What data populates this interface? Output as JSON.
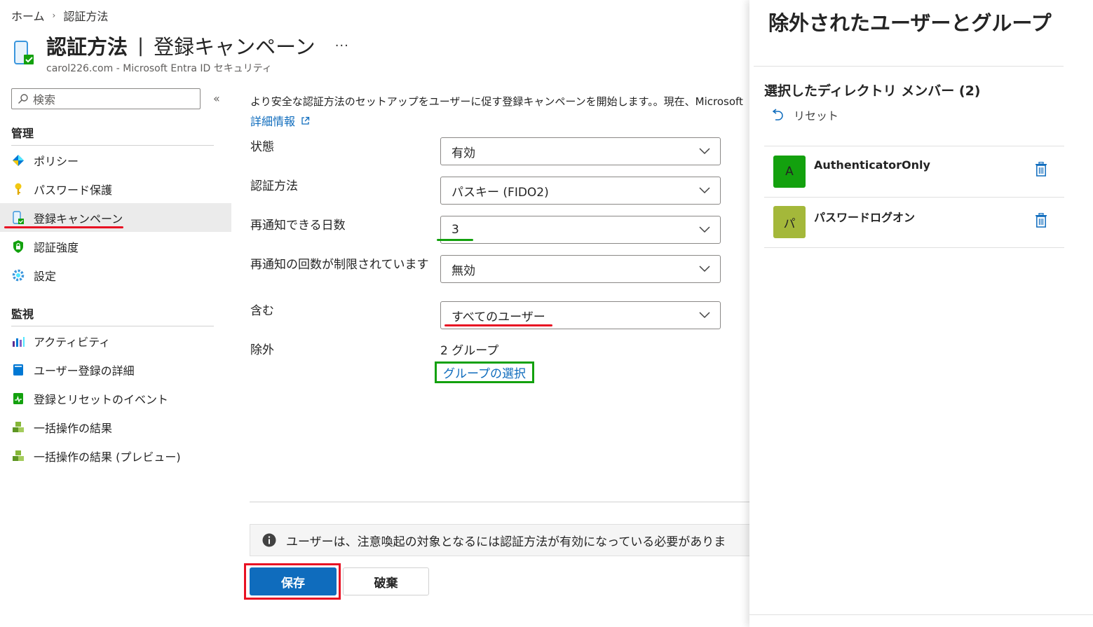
{
  "breadcrumb": {
    "home": "ホーム",
    "sep": "›",
    "current": "認証方法"
  },
  "header": {
    "title": "認証方法",
    "pipe": "|",
    "subtitle": "登録キャンペーン",
    "more": "···",
    "tenant": "carol226.com - Microsoft Entra ID セキュリティ"
  },
  "sidebar": {
    "search_placeholder": "検索",
    "collapse": "«",
    "sections": [
      {
        "heading": "管理",
        "items": [
          {
            "label": "ポリシー",
            "icon": "policy-icon"
          },
          {
            "label": "パスワード保護",
            "icon": "key-icon"
          },
          {
            "label": "登録キャンペーン",
            "icon": "phone-check-icon",
            "active": true
          },
          {
            "label": "認証強度",
            "icon": "shield-lock-icon"
          },
          {
            "label": "設定",
            "icon": "gear-icon"
          }
        ]
      },
      {
        "heading": "監視",
        "items": [
          {
            "label": "アクティビティ",
            "icon": "bar-chart-icon"
          },
          {
            "label": "ユーザー登録の詳細",
            "icon": "book-icon"
          },
          {
            "label": "登録とリセットのイベント",
            "icon": "activity-log-icon"
          },
          {
            "label": "一括操作の結果",
            "icon": "cubes-icon"
          },
          {
            "label": "一括操作の結果 (プレビュー)",
            "icon": "cubes-icon"
          }
        ]
      }
    ]
  },
  "main": {
    "description": "より安全な認証方法のセットアップをユーザーに促す登録キャンペーンを開始します。。現在、Microsoft",
    "learn_more": "詳細情報",
    "fields": {
      "state": {
        "label": "状態",
        "value": "有効"
      },
      "auth_method": {
        "label": "認証方法",
        "value": "パスキー (FIDO2)"
      },
      "snooze_days": {
        "label": "再通知できる日数",
        "value": "3"
      },
      "limited_snooze": {
        "label": "再通知の回数が制限されています",
        "value": "無効"
      },
      "include": {
        "label": "含む",
        "value": "すべてのユーザー"
      },
      "exclude": {
        "label": "除外",
        "count": "2 グループ",
        "link": "グループの選択"
      }
    },
    "info": "ユーザーは、注意喚起の対象となるには認証方法が有効になっている必要がありま",
    "save": "保存",
    "discard": "破棄"
  },
  "panel": {
    "title": "除外されたユーザーとグループ",
    "subtitle": "選択したディレクトリ メンバー (2)",
    "reset": "リセット",
    "members": [
      {
        "initial": "A",
        "name": "AuthenticatorOnly",
        "color": "#13a10e"
      },
      {
        "initial": "パ",
        "name": "パスワードログオン",
        "color": "#a4b83a"
      }
    ]
  },
  "colors": {
    "accent": "#0f6cbd",
    "highlight_red": "#e81123",
    "highlight_green": "#13a10e"
  }
}
